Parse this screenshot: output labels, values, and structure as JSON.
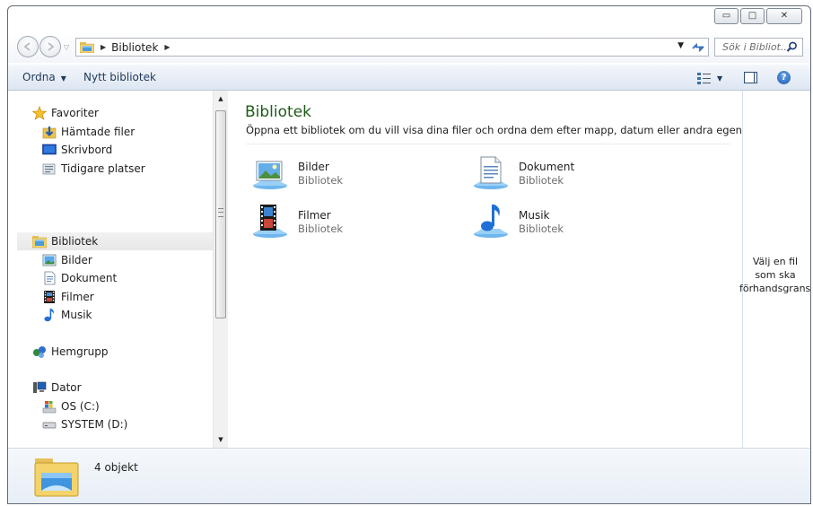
{
  "window": {
    "caption_minimize": "▭",
    "caption_maximize": "□",
    "caption_close": "✕"
  },
  "address_bar": {
    "crumbs": [
      "Bibliotek"
    ],
    "search_placeholder": "Sök i Bibliot..."
  },
  "toolbar": {
    "organize_label": "Ordna",
    "new_library_label": "Nytt bibliotek"
  },
  "nav_pane": {
    "favorites": {
      "label": "Favoriter",
      "items": [
        "Hämtade filer",
        "Skrivbord",
        "Tidigare platser"
      ]
    },
    "libraries": {
      "label": "Bibliotek",
      "items": [
        "Bilder",
        "Dokument",
        "Filmer",
        "Musik"
      ]
    },
    "homegroup": {
      "label": "Hemgrupp"
    },
    "computer": {
      "label": "Dator",
      "items": [
        "OS (C:)",
        "SYSTEM (D:)"
      ]
    }
  },
  "content": {
    "title": "Bibliotek",
    "description": "Öppna ett bibliotek om du vill visa dina filer och ordna dem efter mapp, datum eller andra egenskaper.",
    "libraries": [
      {
        "name": "Bilder",
        "type": "Bibliotek",
        "icon": "pictures-library-icon"
      },
      {
        "name": "Dokument",
        "type": "Bibliotek",
        "icon": "documents-library-icon"
      },
      {
        "name": "Filmer",
        "type": "Bibliotek",
        "icon": "videos-library-icon"
      },
      {
        "name": "Musik",
        "type": "Bibliotek",
        "icon": "music-library-icon"
      }
    ]
  },
  "preview_pane": {
    "lines": [
      "Välj en fil",
      "som ska",
      "förhandsgranskas."
    ]
  },
  "details_pane": {
    "item_count": "4 objekt"
  },
  "colors": {
    "title_green": "#1e5b18",
    "link_blue": "#1e395b",
    "toolbar_top": "#f4f7fb",
    "toolbar_bottom": "#dde6f2"
  }
}
